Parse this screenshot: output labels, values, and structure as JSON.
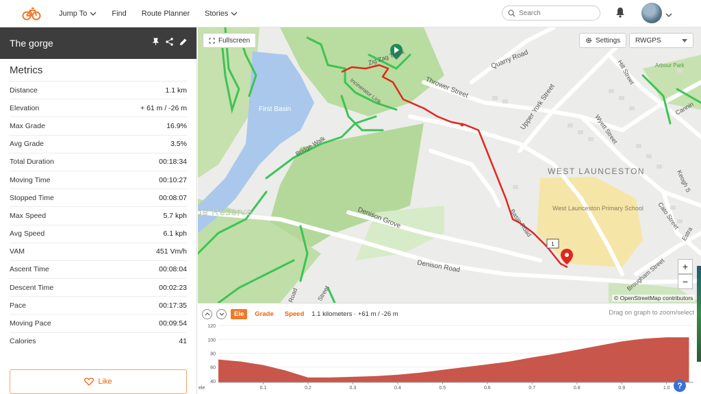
{
  "nav": {
    "links": [
      "Jump To",
      "Find",
      "Route Planner",
      "Stories"
    ],
    "search_placeholder": "Search"
  },
  "route": {
    "title": "The gorge"
  },
  "metrics": {
    "title": "Metrics",
    "rows": [
      {
        "label": "Distance",
        "value": "1.1 km"
      },
      {
        "label": "Elevation",
        "value": "+ 61 m / -26 m"
      },
      {
        "label": "Max Grade",
        "value": "16.9%"
      },
      {
        "label": "Avg Grade",
        "value": "3.5%"
      },
      {
        "label": "Total Duration",
        "value": "00:18:34"
      },
      {
        "label": "Moving Time",
        "value": "00:10:27"
      },
      {
        "label": "Stopped Time",
        "value": "00:08:07"
      },
      {
        "label": "Max Speed",
        "value": "5.7 kph"
      },
      {
        "label": "Avg Speed",
        "value": "6.1 kph"
      },
      {
        "label": "VAM",
        "value": "451 Vm/h"
      },
      {
        "label": "Ascent Time",
        "value": "00:08:04"
      },
      {
        "label": "Descent Time",
        "value": "00:02:23"
      },
      {
        "label": "Pace",
        "value": "00:17:35"
      },
      {
        "label": "Moving Pace",
        "value": "00:09:54"
      },
      {
        "label": "Calories",
        "value": "41"
      }
    ],
    "like_label": "Like"
  },
  "map": {
    "fullscreen_label": "Fullscreen",
    "settings_label": "Settings",
    "layer_value": "RWGPS",
    "attribution": "© OpenStreetMap contributors",
    "labels": [
      "First Basin",
      "Zig Zag Track",
      "Incinerator Link",
      "Bridge Walk",
      "Quarry Road",
      "Thrower Street",
      "Upper York Street",
      "Hill Street",
      "Arbour Park",
      "Cannin",
      "Wyett Street",
      "WEST LAUNCESTON",
      "Keogh S",
      "Cato Street",
      "Estra",
      "Denison Grove",
      "Denison Road",
      "Basin Road",
      "West Launceston Primary School",
      "Brougham Street",
      "ge Reserve",
      "Road",
      "Street"
    ],
    "marker_label": "1",
    "colors": {
      "route": "#e2261d",
      "trail": "#3cc453",
      "park": "#b9dca0",
      "water": "#a9c8ec",
      "school": "#f5e6a8"
    }
  },
  "graph": {
    "tabs": [
      "Ele",
      "Grade",
      "Speed"
    ],
    "summary": "1.1 kilometers · +61 m / -26 m",
    "hint": "Drag on graph to zoom/select",
    "y_ticks": [
      "120",
      "100",
      "80",
      "60",
      "40"
    ],
    "x_ticks": [
      "0.1",
      "0.2",
      "0.3",
      "0.4",
      "0.5",
      "0.6",
      "0.7",
      "0.8",
      "0.9",
      "1.0"
    ],
    "y_axis_label": "ele",
    "x": [
      0,
      0.05,
      0.1,
      0.15,
      0.2,
      0.25,
      0.3,
      0.35,
      0.4,
      0.45,
      0.5,
      0.55,
      0.6,
      0.65,
      0.7,
      0.75,
      0.8,
      0.85,
      0.9,
      0.95,
      1.0,
      1.05
    ],
    "y": [
      71,
      68,
      63,
      55,
      45,
      45,
      46,
      47,
      49,
      52,
      56,
      60,
      64,
      68,
      74,
      79,
      85,
      91,
      97,
      101,
      103,
      103
    ],
    "ylim": [
      38,
      122
    ],
    "xlim": [
      0,
      1.06
    ],
    "fill": "#c9564a"
  }
}
